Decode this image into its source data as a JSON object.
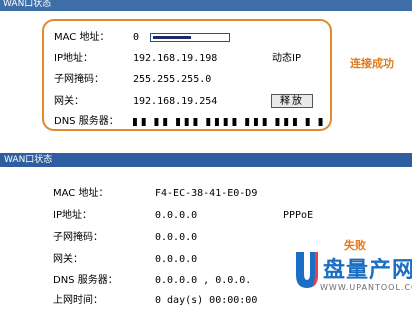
{
  "panel_connected": {
    "title": "WAN口状态",
    "rows": [
      {
        "label": "MAC 地址：",
        "value": "0"
      },
      {
        "label": "IP地址：",
        "value": "192.168.19.198",
        "extra": "动态IP"
      },
      {
        "label": "子网掩码：",
        "value": "255.255.255.0"
      },
      {
        "label": "网关：",
        "value": "192.168.19.254"
      },
      {
        "label": "DNS 服务器："
      }
    ],
    "release_button": "释放",
    "annotation": "连接成功"
  },
  "panel_failed": {
    "title": "WAN口状态",
    "rows": [
      {
        "label": "MAC 地址：",
        "value": "F4-EC-38-41-E0-D9"
      },
      {
        "label": "IP地址：",
        "value": "0.0.0.0",
        "extra": "PPPoE"
      },
      {
        "label": "子网掩码：",
        "value": "0.0.0.0"
      },
      {
        "label": "网关：",
        "value": "0.0.0.0"
      },
      {
        "label": "DNS 服务器：",
        "value": "0.0.0.0 , 0.0.0."
      },
      {
        "label": "上网时间：",
        "value": "0 day(s) 00:00:00"
      }
    ],
    "annotation": "失败"
  },
  "watermark": {
    "brand": "盘量产网",
    "site": "WWW.UPANTOOL.COM"
  },
  "colors": {
    "title_bar": "#3d6ea8",
    "annotation": "#e07b1a",
    "highlight_border": "#e08a2a",
    "watermark_blue": "#1a6fc4"
  },
  "icons": [
    "u-logo-icon"
  ]
}
